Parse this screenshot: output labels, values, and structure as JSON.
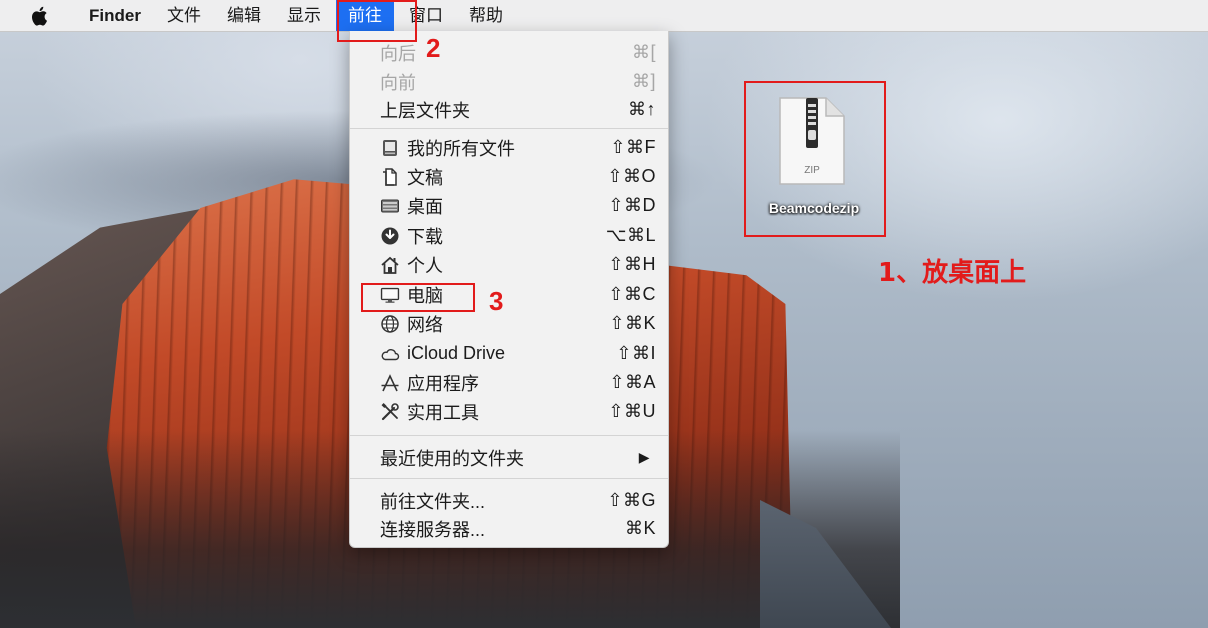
{
  "menubar": {
    "app_name": "Finder",
    "items": [
      "文件",
      "编辑",
      "显示",
      "前往",
      "窗口",
      "帮助"
    ],
    "active_index": 3
  },
  "go_menu": {
    "items": [
      {
        "label": "向后",
        "shortcut": "⌘[",
        "disabled": true,
        "icon": null
      },
      {
        "label": "向前",
        "shortcut": "⌘]",
        "disabled": true,
        "icon": null
      },
      {
        "label": "上层文件夹",
        "shortcut": "⌘↑",
        "disabled": false,
        "icon": null
      },
      {
        "label": "我的所有文件",
        "shortcut": "⇧⌘F",
        "disabled": false,
        "icon": "all-files-icon"
      },
      {
        "label": "文稿",
        "shortcut": "⇧⌘O",
        "disabled": false,
        "icon": "documents-icon"
      },
      {
        "label": "桌面",
        "shortcut": "⇧⌘D",
        "disabled": false,
        "icon": "desktop-icon"
      },
      {
        "label": "下载",
        "shortcut": "⌥⌘L",
        "disabled": false,
        "icon": "download-icon"
      },
      {
        "label": "个人",
        "shortcut": "⇧⌘H",
        "disabled": false,
        "icon": "home-icon"
      },
      {
        "label": "电脑",
        "shortcut": "⇧⌘C",
        "disabled": false,
        "icon": "computer-icon"
      },
      {
        "label": "网络",
        "shortcut": "⇧⌘K",
        "disabled": false,
        "icon": "network-icon"
      },
      {
        "label": "iCloud Drive",
        "shortcut": "⇧⌘I",
        "disabled": false,
        "icon": "cloud-icon"
      },
      {
        "label": "应用程序",
        "shortcut": "⇧⌘A",
        "disabled": false,
        "icon": "applications-icon"
      },
      {
        "label": "实用工具",
        "shortcut": "⇧⌘U",
        "disabled": false,
        "icon": "utilities-icon"
      },
      {
        "label": "最近使用的文件夹",
        "shortcut": "▶",
        "disabled": false,
        "icon": null
      },
      {
        "label": "前往文件夹...",
        "shortcut": "⇧⌘G",
        "disabled": false,
        "icon": null
      },
      {
        "label": "连接服务器...",
        "shortcut": "⌘K",
        "disabled": false,
        "icon": null
      }
    ]
  },
  "desktop_file": {
    "type_label": "ZIP",
    "name": "Beamcodezip"
  },
  "annotations": {
    "step1": "1、放桌面上",
    "step2": "2",
    "step3": "3"
  },
  "colors": {
    "highlight_blue": "#1d6ff2",
    "annotation_red": "#e21b1b"
  }
}
